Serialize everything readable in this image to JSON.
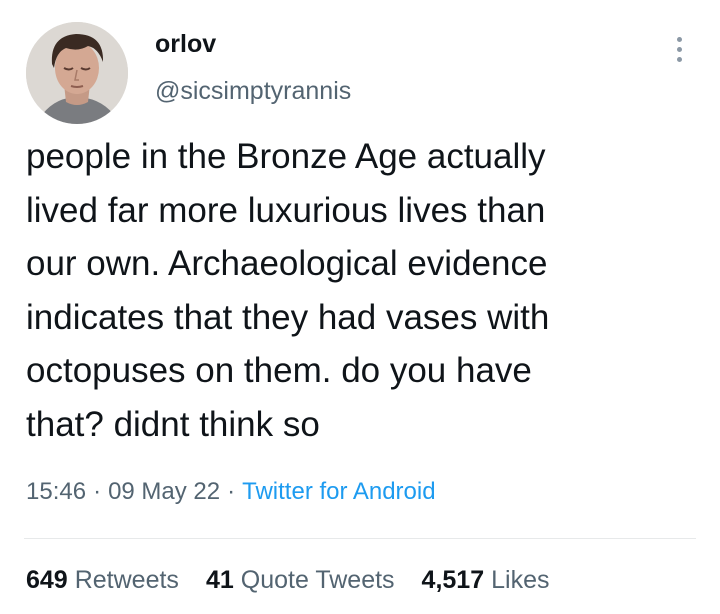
{
  "author": {
    "display_name": "orlov",
    "handle": "@sicsimptyrannis"
  },
  "tweet": {
    "text_lines": [
      "people in the Bronze Age actually",
      "lived far more luxurious lives than",
      "our own. Archaeological evidence",
      "indicates that they had vases with",
      "octopuses on them. do you have",
      "that? didnt think so"
    ],
    "time": "15:46",
    "date": "09 May 22",
    "separator": "·",
    "source": "Twitter for Android"
  },
  "stats": {
    "retweets_count": "649",
    "retweets_label": "Retweets",
    "quotes_count": "41",
    "quotes_label": "Quote Tweets",
    "likes_count": "4,517",
    "likes_label": "Likes"
  },
  "icons": {
    "more": "more-vertical-icon",
    "avatar": "profile-photo"
  },
  "colors": {
    "text_primary": "#0f1419",
    "text_secondary": "#536471",
    "link": "#1d9bf0",
    "divider": "#e7e9ea"
  }
}
